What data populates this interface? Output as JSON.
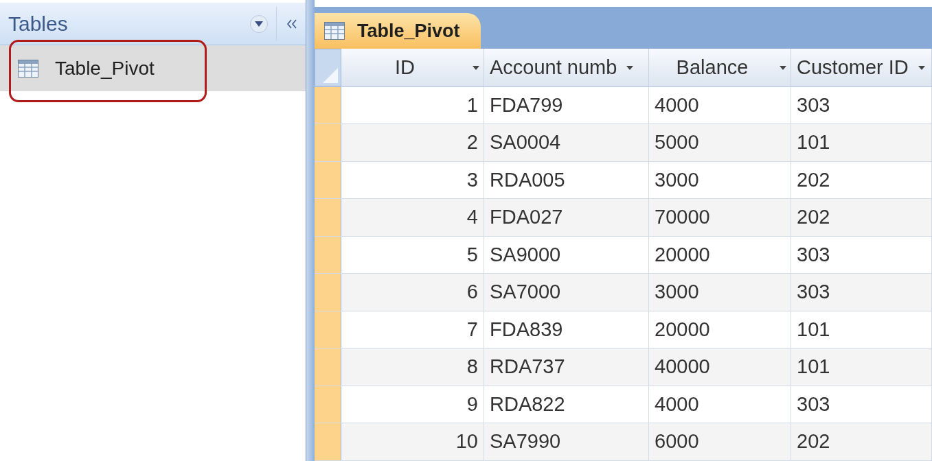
{
  "navigation_pane": {
    "title": "Tables",
    "items": [
      {
        "label": "Table_Pivot",
        "selected": true,
        "circled": true
      }
    ]
  },
  "document_tab": {
    "label": "Table_Pivot",
    "selected": true
  },
  "table": {
    "columns": [
      "ID",
      "Account numb",
      "Balance",
      "Customer ID"
    ],
    "rows": [
      [
        "1",
        "FDA799",
        "4000",
        "303"
      ],
      [
        "2",
        "SA0004",
        "5000",
        "101"
      ],
      [
        "3",
        "RDA005",
        "3000",
        "202"
      ],
      [
        "4",
        "FDA027",
        "70000",
        "202"
      ],
      [
        "5",
        "SA9000",
        "20000",
        "303"
      ],
      [
        "6",
        "SA7000",
        "3000",
        "303"
      ],
      [
        "7",
        "FDA839",
        "20000",
        "101"
      ],
      [
        "8",
        "RDA737",
        "40000",
        "101"
      ],
      [
        "9",
        "RDA822",
        "4000",
        "303"
      ],
      [
        "10",
        "SA7990",
        "6000",
        "202"
      ]
    ]
  }
}
